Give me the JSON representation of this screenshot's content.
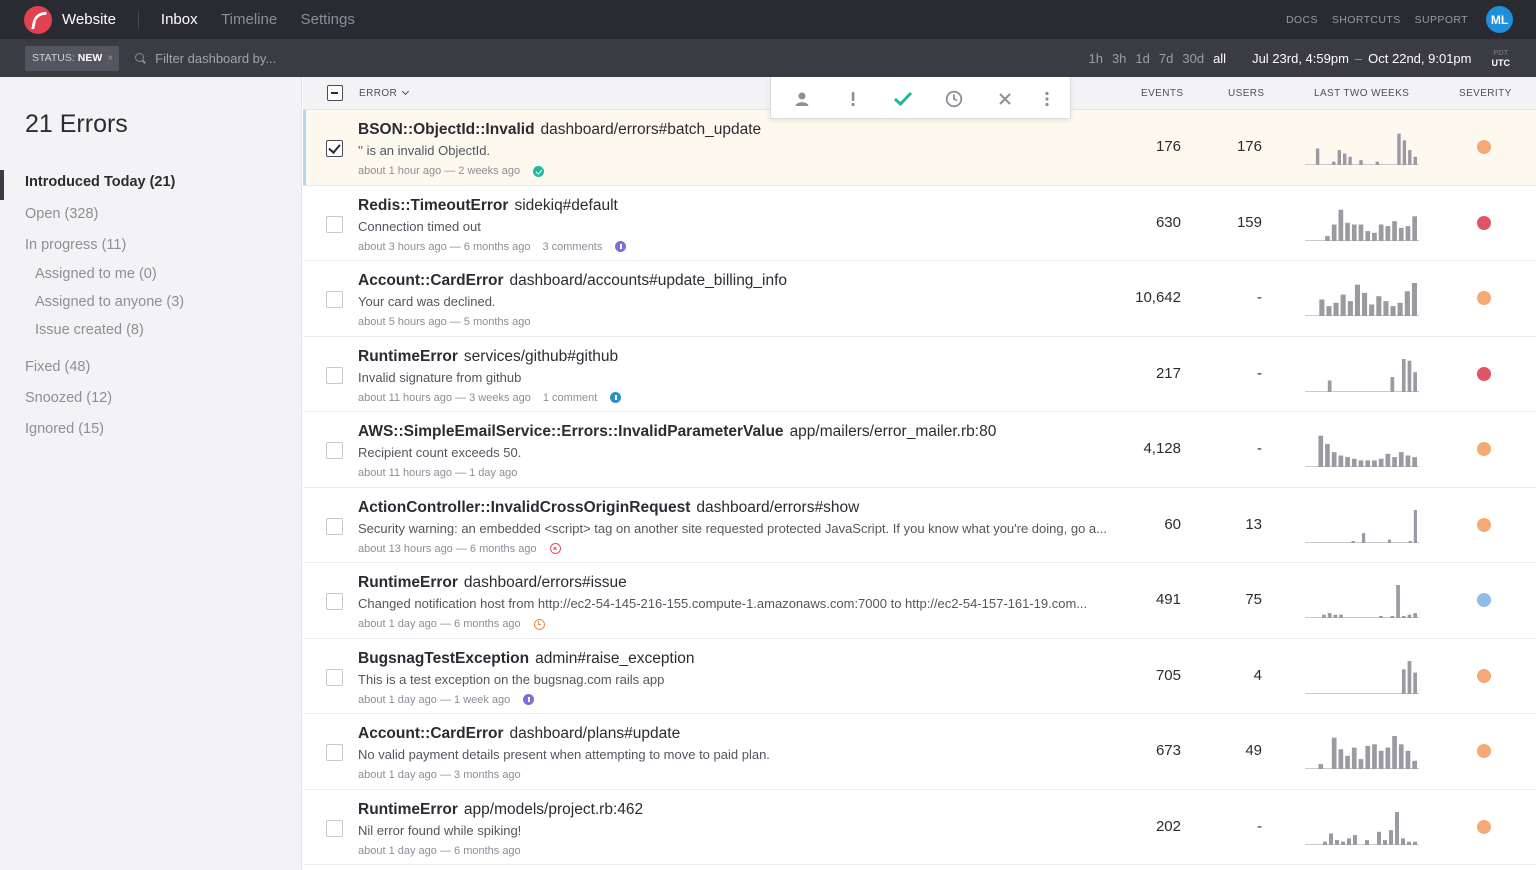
{
  "topbar": {
    "project": "Website",
    "nav": [
      "Inbox",
      "Timeline",
      "Settings"
    ],
    "links": [
      "DOCS",
      "SHORTCUTS",
      "SUPPORT"
    ],
    "avatar": "ML"
  },
  "filterbar": {
    "status_label": "STATUS:",
    "status_value": "NEW",
    "status_close": "×",
    "placeholder": "Filter dashboard by...",
    "ranges": [
      "1h",
      "3h",
      "1d",
      "7d",
      "30d",
      "all"
    ],
    "date_from": "Jul 23rd, 4:59pm",
    "date_sep": "–",
    "date_to": "Oct 22nd, 9:01pm",
    "tz_top": "PDT",
    "tz_bottom": "UTC"
  },
  "sidebar": {
    "title": "21 Errors",
    "items": [
      "Introduced Today (21)",
      "Open (328)",
      "In progress (11)",
      "Assigned to me (0)",
      "Assigned to anyone (3)",
      "Issue created (8)",
      "Fixed (48)",
      "Snoozed (12)",
      "Ignored (15)"
    ]
  },
  "table": {
    "headers": {
      "error": "ERROR",
      "events": "EVENTS",
      "users": "USERS",
      "trend": "LAST TWO WEEKS",
      "severity": "SEVERITY"
    },
    "rows": [
      {
        "cls": "BSON::ObjectId::Invalid",
        "ctx": "dashboard/errors#batch_update",
        "msg": "'' is an invalid ObjectId.",
        "meta": "about 1 hour ago — 2 weeks ago",
        "comments": "",
        "icon": "ok",
        "events": "176",
        "users": "176",
        "severity": "#f5a975",
        "spark": [
          0,
          0,
          0.5,
          0,
          0,
          0.1,
          0.45,
          0.35,
          0.25,
          0,
          0.15,
          0,
          0,
          0.1,
          0,
          0,
          0,
          0.95,
          0.75,
          0.45,
          0.25
        ],
        "checked": true
      },
      {
        "cls": "Redis::TimeoutError",
        "ctx": "sidekiq#default",
        "msg": "Connection timed out",
        "meta": "about 3 hours ago — 6 months ago",
        "comments": "3 comments",
        "icon": "info",
        "events": "630",
        "users": "159",
        "severity": "#e05565",
        "spark": [
          0,
          0,
          0,
          0.15,
          0.5,
          0.95,
          0.55,
          0.5,
          0.5,
          0.3,
          0.25,
          0.5,
          0.45,
          0.6,
          0.4,
          0.45,
          0.75
        ],
        "checked": false
      },
      {
        "cls": "Account::CardError",
        "ctx": "dashboard/accounts#update_billing_info",
        "msg": "Your card was declined.",
        "meta": "about 5 hours ago — 5 months ago",
        "comments": "",
        "icon": "",
        "events": "10,642",
        "users": "-",
        "severity": "#f5a975",
        "spark": [
          0,
          0,
          0.5,
          0.3,
          0.4,
          0.65,
          0.45,
          0.95,
          0.7,
          0.35,
          0.6,
          0.45,
          0.3,
          0.4,
          0.75,
          1.0
        ],
        "checked": false
      },
      {
        "cls": "RuntimeError",
        "ctx": "services/github#github",
        "msg": "Invalid signature from github",
        "meta": "about 11 hours ago — 3 weeks ago",
        "comments": "1 comment",
        "icon": "info blue",
        "events": "217",
        "users": "-",
        "severity": "#e05565",
        "spark": [
          0,
          0,
          0,
          0,
          0.35,
          0,
          0,
          0,
          0,
          0,
          0,
          0,
          0,
          0,
          0,
          0.45,
          0,
          1.0,
          0.95,
          0.6
        ],
        "checked": false
      },
      {
        "cls": "AWS::SimpleEmailService::Errors::InvalidParameterValue",
        "ctx": "app/mailers/error_mailer.rb:80",
        "msg": "Recipient count exceeds 50.",
        "meta": "about 11 hours ago — 1 day ago",
        "comments": "",
        "icon": "",
        "events": "4,128",
        "users": "-",
        "severity": "#f5a975",
        "spark": [
          0,
          0,
          0.95,
          0.7,
          0.45,
          0.35,
          0.3,
          0.25,
          0.2,
          0.2,
          0.2,
          0.25,
          0.4,
          0.3,
          0.45,
          0.35,
          0.3
        ],
        "checked": false
      },
      {
        "cls": "ActionController::InvalidCrossOriginRequest",
        "ctx": "dashboard/errors#show",
        "msg": "Security warning: an embedded <script> tag on another site requested protected JavaScript. If you know what you're doing, go a...",
        "meta": "about 13 hours ago — 6 months ago",
        "comments": "",
        "icon": "x",
        "events": "60",
        "users": "13",
        "severity": "#f5a975",
        "spark": [
          0,
          0,
          0,
          0,
          0,
          0,
          0,
          0,
          0,
          0.05,
          0,
          0.3,
          0,
          0,
          0,
          0,
          0.1,
          0,
          0,
          0,
          0.05,
          1.0
        ],
        "checked": false
      },
      {
        "cls": "RuntimeError",
        "ctx": "dashboard/errors#issue",
        "msg": "Changed notification host from http://ec2-54-145-216-155.compute-1.amazonaws.com:7000 to http://ec2-54-157-161-19.com...",
        "meta": "about 1 day ago — 6 months ago",
        "comments": "",
        "icon": "snooze",
        "events": "491",
        "users": "75",
        "severity": "#8fbde8",
        "spark": [
          0,
          0,
          0,
          0.1,
          0.15,
          0.1,
          0.1,
          0,
          0,
          0,
          0,
          0,
          0,
          0.05,
          0,
          0.05,
          1.0,
          0.05,
          0.1,
          0.15
        ],
        "checked": false
      },
      {
        "cls": "BugsnagTestException",
        "ctx": "admin#raise_exception",
        "msg": "This is a test exception on the bugsnag.com rails app",
        "meta": "about 1 day ago — 1 week ago",
        "comments": "",
        "icon": "info",
        "events": "705",
        "users": "4",
        "severity": "#f5a975",
        "spark": [
          0,
          0,
          0,
          0,
          0,
          0,
          0,
          0,
          0,
          0,
          0,
          0,
          0,
          0,
          0,
          0,
          0,
          0.75,
          1.0,
          0.65
        ],
        "checked": false
      },
      {
        "cls": "Account::CardError",
        "ctx": "dashboard/plans#update",
        "msg": "No valid payment details present when attempting to move to paid plan.",
        "meta": "about 1 day ago — 3 months ago",
        "comments": "",
        "icon": "",
        "events": "673",
        "users": "49",
        "severity": "#f5a975",
        "spark": [
          0,
          0,
          0.15,
          0,
          0.95,
          0.6,
          0.4,
          0.65,
          0.3,
          0.7,
          0.75,
          0.55,
          0.65,
          1.0,
          0.75,
          0.55,
          0.25
        ],
        "checked": false
      },
      {
        "cls": "RuntimeError",
        "ctx": "app/models/project.rb:462",
        "msg": "Nil error found while spiking!",
        "meta": "about 1 day ago — 6 months ago",
        "comments": "",
        "icon": "",
        "events": "202",
        "users": "-",
        "severity": "#f5a975",
        "spark": [
          0,
          0,
          0,
          0.1,
          0.35,
          0.15,
          0.1,
          0.2,
          0.3,
          0,
          0.15,
          0,
          0.4,
          0.15,
          0.45,
          1.0,
          0.2,
          0.1,
          0.1
        ],
        "checked": false
      }
    ]
  }
}
